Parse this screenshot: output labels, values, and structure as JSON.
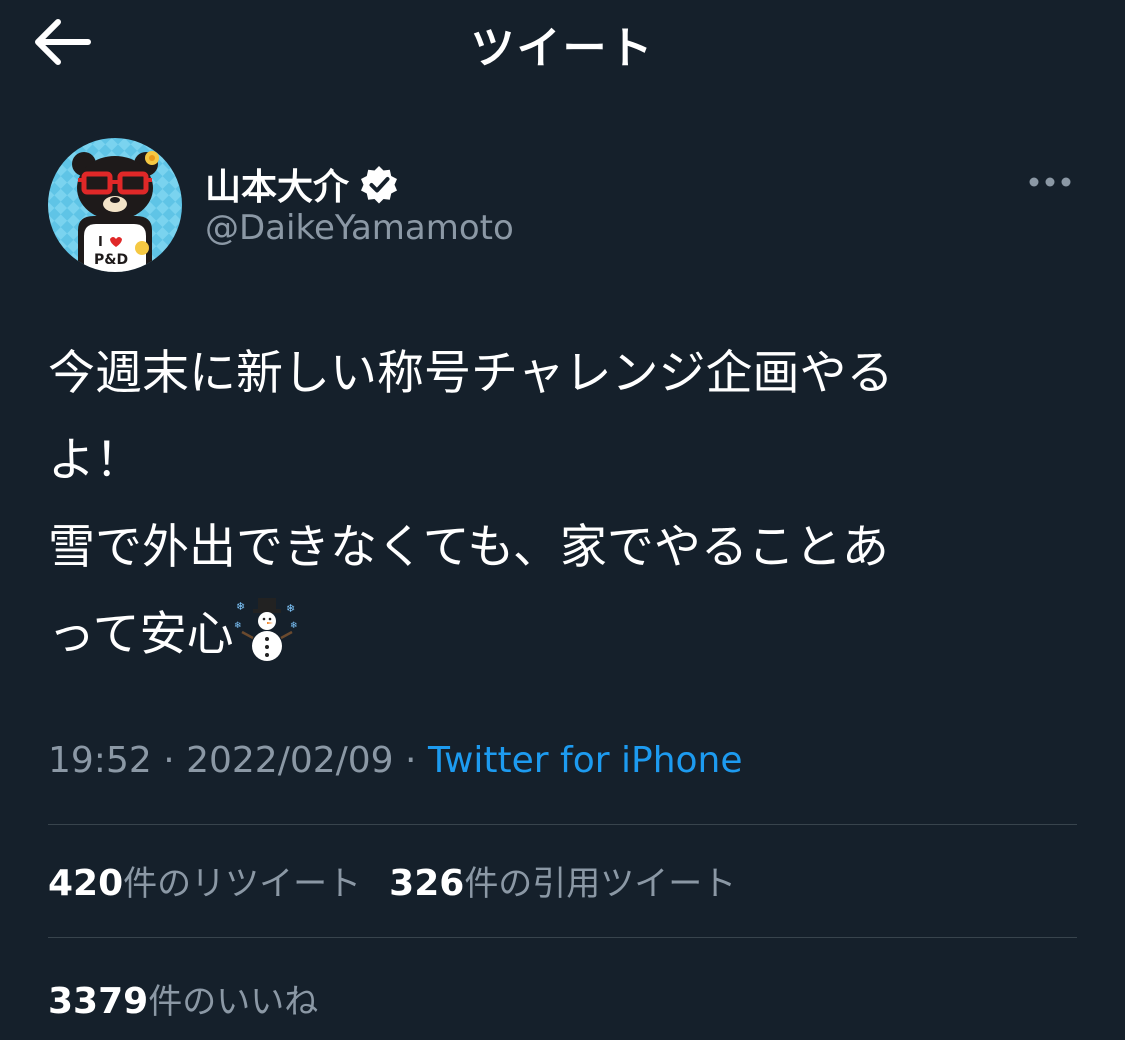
{
  "header": {
    "title": "ツイート",
    "back_icon": "arrow-left-icon"
  },
  "user": {
    "name": "山本大介",
    "handle": "@DaikeYamamoto",
    "verified_icon": "verified-badge-icon",
    "avatar_icon": "bear-avatar-icon",
    "avatar_shirt_text": "I ♥ P&D"
  },
  "more_icon": "more-options-icon",
  "tweet": {
    "line1": "今週末に新しい称号チャレンジ企画やる",
    "line2": "よ！",
    "line3": "雪で外出できなくても、家でやることあ",
    "line4": "って安心",
    "emoji": "snowman-icon"
  },
  "meta": {
    "time": "19:52",
    "sep1": " · ",
    "date": "2022/02/09",
    "sep2": " · ",
    "source": "Twitter for iPhone"
  },
  "stats": {
    "retweets_count": "420",
    "retweets_label": "件のリツイート",
    "quotes_count": "326",
    "quotes_label": "件の引用ツイート",
    "likes_count": "3379",
    "likes_label": "件のいいね"
  },
  "colors": {
    "background": "#15202b",
    "text": "#ffffff",
    "secondary": "#8b98a5",
    "link": "#1d9bf0",
    "divider": "#38444d"
  }
}
